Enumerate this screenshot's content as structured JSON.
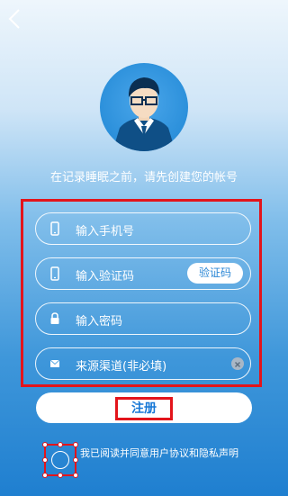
{
  "nav": {
    "back_icon": "chevron-left-icon"
  },
  "avatar": {
    "icon": "user-avatar-glasses"
  },
  "subtitle": "在记录睡眠之前，请先创建您的帐号",
  "form": {
    "phone": {
      "placeholder": "输入手机号",
      "icon": "phone-icon"
    },
    "code": {
      "placeholder": "输入验证码",
      "icon": "phone-icon",
      "button_label": "验证码"
    },
    "password": {
      "placeholder": "输入密码",
      "icon": "lock-icon"
    },
    "source": {
      "placeholder": "来源渠道(非必填)",
      "icon": "mail-icon",
      "clear_icon": "clear-icon"
    }
  },
  "register_label": "注册",
  "agreement": {
    "text": "我已阅读并同意用户协议和隐私声明",
    "checked": false
  },
  "colors": {
    "accent": "#1778d6",
    "highlight": "#e3141b",
    "gradient_top": "#eef6fc",
    "gradient_bottom": "#1f7fd0"
  }
}
